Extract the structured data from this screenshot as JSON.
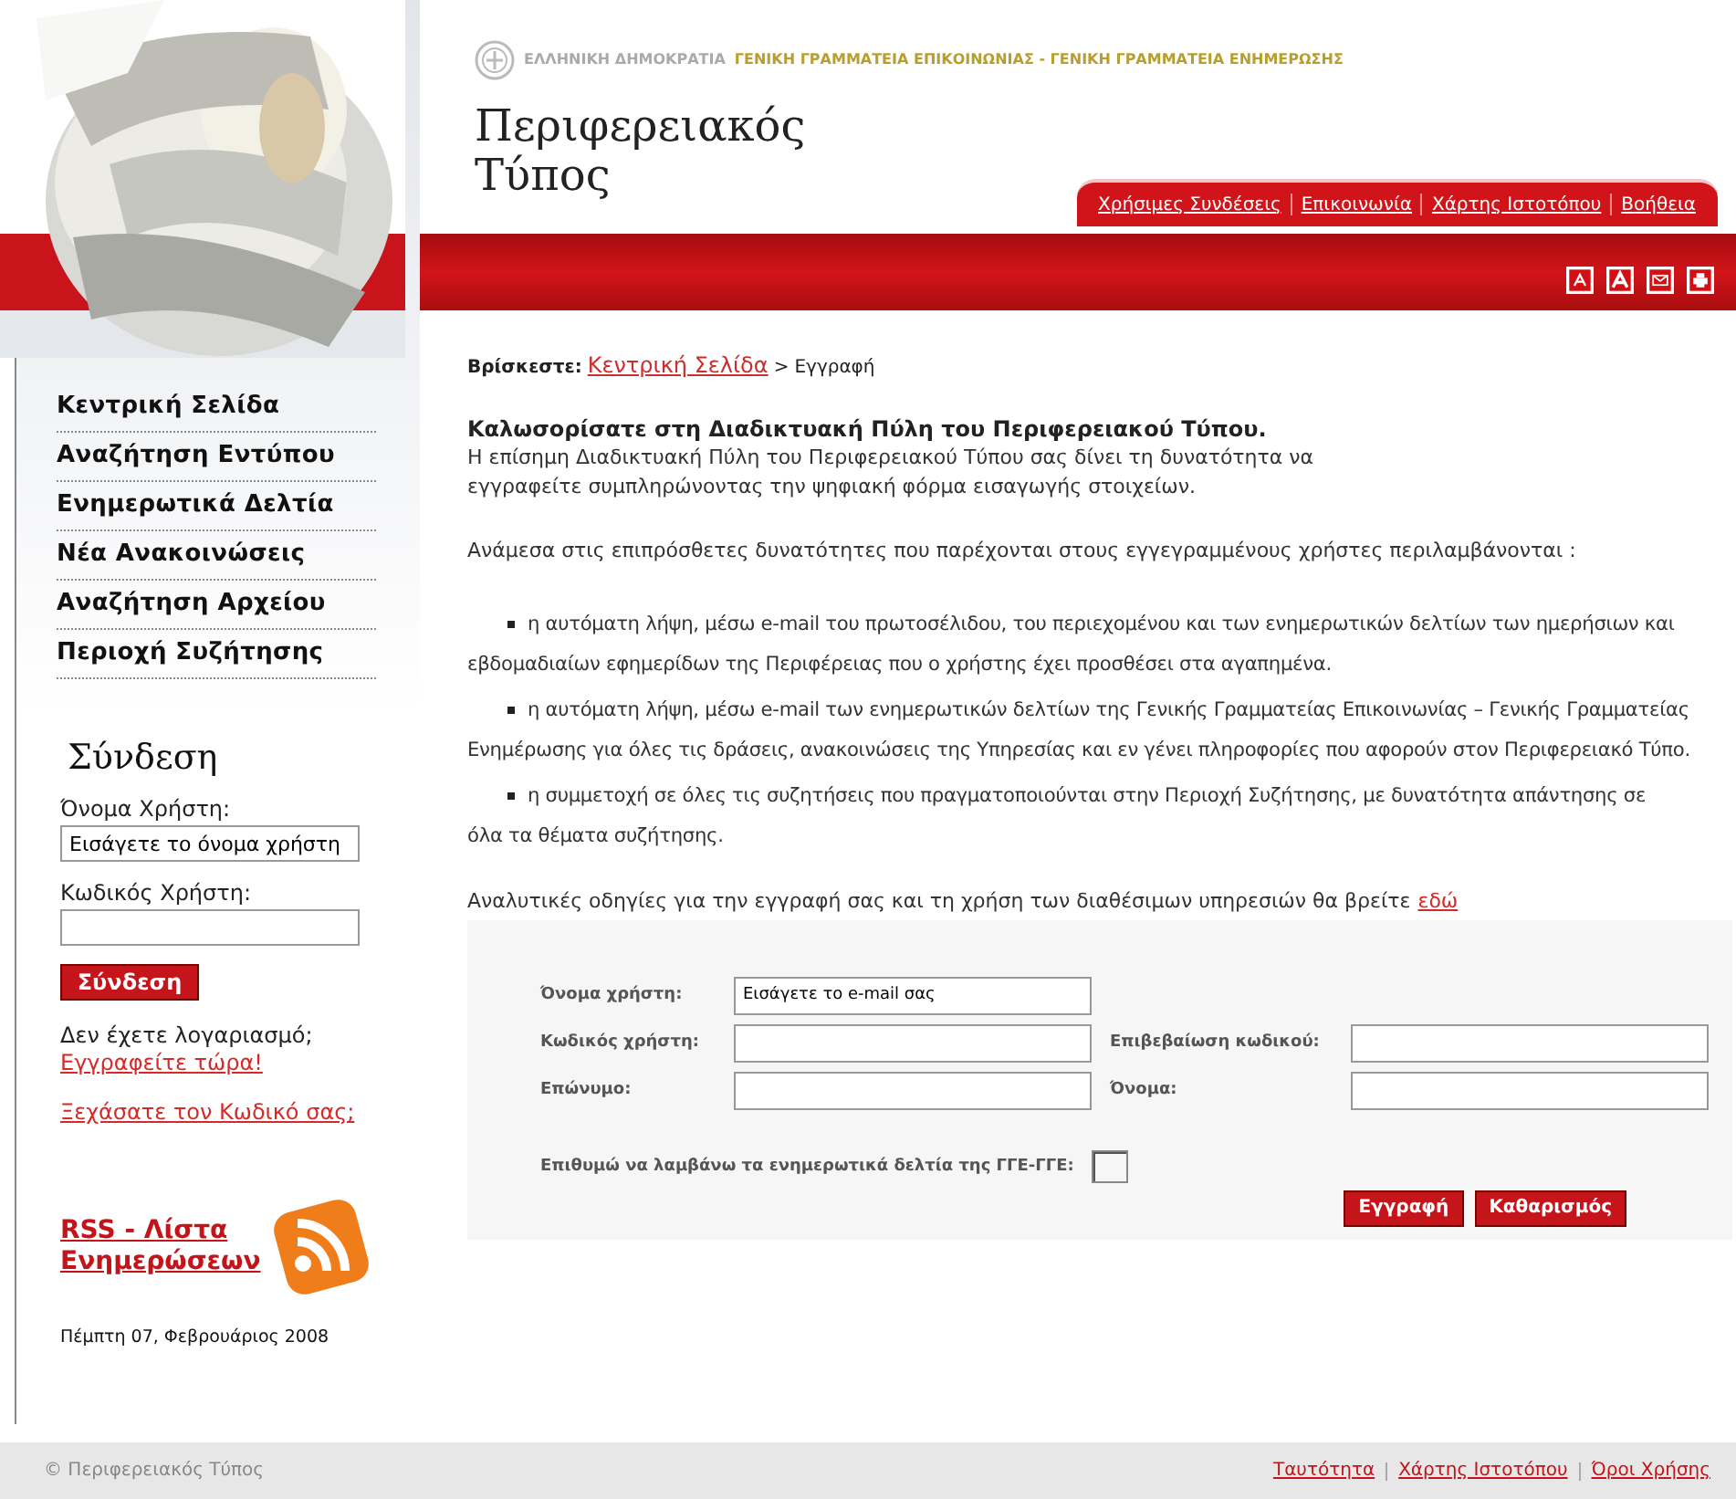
{
  "header": {
    "republic": "ΕΛΛΗΝΙΚΗ ΔΗΜΟΚΡΑΤΙΑ",
    "ministries": "ΓΕΝΙΚΗ ΓΡΑΜΜΑΤΕΙΑ ΕΠΙΚΟΙΝΩΝΙΑΣ - ΓΕΝΙΚΗ ΓΡΑΜΜΑΤΕΙΑ ΕΝΗΜΕΡΩΣΗΣ",
    "title_lines": [
      "Περιφερειακός",
      "Τύπος"
    ],
    "top_links": [
      "Χρήσιμες Συνδέσεις",
      "Επικοινωνία",
      "Χάρτης Ιστοτόπου",
      "Βοήθεια"
    ],
    "tools": [
      {
        "kind": "font-small"
      },
      {
        "kind": "font-large"
      },
      {
        "kind": "mail"
      },
      {
        "kind": "print"
      }
    ]
  },
  "sidebar": {
    "items": [
      {
        "label": "Κεντρική Σελίδα"
      },
      {
        "label": "Αναζήτηση Εντύπου"
      },
      {
        "label": "Ενημερωτικά Δελτία"
      },
      {
        "label": "Νέα Ανακοινώσεις"
      },
      {
        "label": "Αναζήτηση Αρχείου"
      },
      {
        "label": "Περιοχή Συζήτησης"
      }
    ],
    "login": {
      "title": "Σύνδεση",
      "username_label": "Όνομα Χρήστη:",
      "username_value": "Εισάγετε το όνομα χρήστη",
      "password_label": "Κωδικός Χρήστη:",
      "button": "Σύνδεση",
      "no_account": "Δεν έχετε λογαριασμό;",
      "register_link": "Εγγραφείτε τώρα!",
      "forgot_link": "Ξεχάσατε τον Κωδικό σας;"
    },
    "rss": "RSS - Λίστα Ενημερώσεων",
    "date": "Πέμπτη 07, Φεβρουάριος 2008"
  },
  "breadcrumb": {
    "label": "Βρίσκεστε:",
    "link": "Κεντρική Σελίδα",
    "separator": ">",
    "current": "Εγγραφή"
  },
  "intro": {
    "heading": "Καλωσορίσατε στη Διαδικτυακή Πύλη του Περιφερειακού Τύπου.",
    "text_lines": [
      "Η επίσημη Διαδικτυακή Πύλη του Περιφερειακού Τύπου σας δίνει τη δυνατότητα να",
      "εγγραφείτε συμπληρώνοντας την ψηφιακή φόρμα εισαγωγής στοιχείων."
    ],
    "features_intro": "Ανάμεσα στις επιπρόσθετες δυνατότητες που παρέχονται στους εγγεγραμμένους χρήστες περιλαμβάνονται :",
    "features": [
      {
        "lines": [
          "η αυτόματη λήψη, μέσω e-mail του πρωτοσέλιδου, του περιεχομένου και των ενημερωτικών δελτίων των ημερήσιων και",
          "εβδομαδιαίων εφημερίδων της Περιφέρειας που ο χρήστης έχει προσθέσει στα αγαπημένα."
        ]
      },
      {
        "lines": [
          "η αυτόματη λήψη, μέσω e-mail των ενημερωτικών δελτίων της Γενικής Γραμματείας Επικοινωνίας – Γενικής Γραμματείας",
          "Ενημέρωσης για όλες τις δράσεις, ανακοινώσεις της Υπηρεσίας και εν γένει πληροφορίες που αφορούν στον Περιφερειακό Τύπο."
        ]
      },
      {
        "lines": [
          "η συμμετοχή σε όλες τις συζητήσεις που πραγματοποιούνται στην Περιοχή Συζήτησης, με δυνατότητα απάντησης σε",
          "όλα τα θέματα συζήτησης."
        ]
      }
    ],
    "instructions": "Αναλυτικές οδηγίες για την εγγραφή σας και τη χρήση των διαθέσιμων υπηρεσιών θα βρείτε",
    "instructions_link": "εδώ"
  },
  "form": {
    "rows": [
      [
        {
          "label": "Όνομα χρήστη:",
          "value": "Εισάγετε το e-mail σας"
        }
      ],
      [
        {
          "label": "Κωδικός χρήστη:"
        },
        {
          "label": "Επιβεβαίωση κωδικού:"
        }
      ],
      [
        {
          "label": "Επώνυμο:"
        },
        {
          "label": "Όνομα:"
        }
      ]
    ],
    "newsletter": {
      "label": "Επιθυμώ να λαμβάνω τα ενημερωτικά δελτία της ΓΓΕ-ΓΓΕ:",
      "checked": false
    },
    "buttons": [
      "Εγγραφή",
      "Καθαρισμός"
    ]
  },
  "footer": {
    "copyright": "© Περιφερειακός Τύπος",
    "links": [
      "Ταυτότητα",
      "Χάρτης Ιστοτόπου",
      "Όροι Χρήσης"
    ]
  }
}
